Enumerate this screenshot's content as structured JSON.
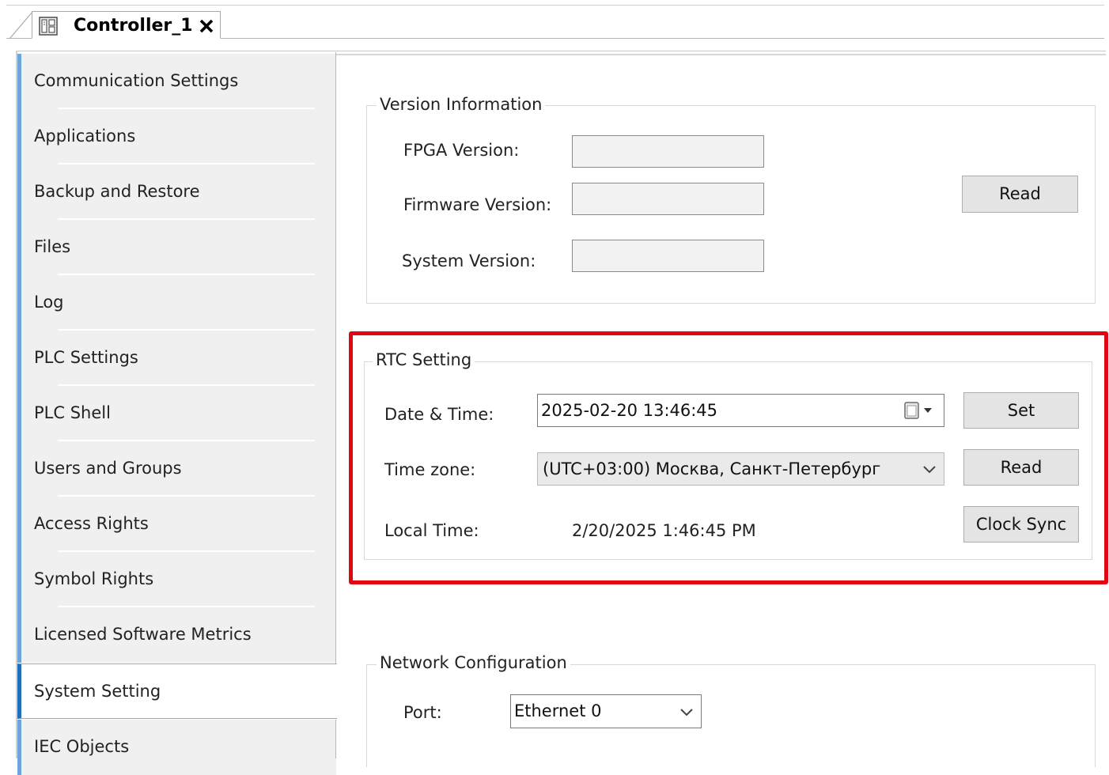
{
  "tab": {
    "title": "Controller_1",
    "close_icon": "close-icon"
  },
  "sidebar": {
    "items": [
      {
        "label": "Communication Settings"
      },
      {
        "label": "Applications"
      },
      {
        "label": "Backup and Restore"
      },
      {
        "label": "Files"
      },
      {
        "label": "Log"
      },
      {
        "label": "PLC Settings"
      },
      {
        "label": "PLC Shell"
      },
      {
        "label": "Users and Groups"
      },
      {
        "label": "Access Rights"
      },
      {
        "label": "Symbol Rights"
      },
      {
        "label": "Licensed Software Metrics"
      },
      {
        "label": "System Setting",
        "active": true
      },
      {
        "label": "IEC Objects"
      }
    ]
  },
  "version_info": {
    "legend": "Version Information",
    "fpga_label": "FPGA Version:",
    "fpga_value": "",
    "firmware_label": "Firmware Version:",
    "firmware_value": "",
    "system_label": "System Version:",
    "system_value": "",
    "read_button": "Read"
  },
  "rtc": {
    "legend": "RTC Setting",
    "datetime_label": "Date & Time:",
    "datetime_value": "2025-02-20 13:46:45",
    "set_button": "Set",
    "timezone_label": "Time zone:",
    "timezone_value": "(UTC+03:00) Москва, Санкт-Петербург",
    "read_button": "Read",
    "localtime_label": "Local Time:",
    "localtime_value": "2/20/2025 1:46:45 PM",
    "clock_sync_button": "Clock Sync"
  },
  "network": {
    "legend": "Network Configuration",
    "port_label": "Port:",
    "port_value": "Ethernet 0"
  },
  "colors": {
    "highlight": "#e10612",
    "active_accent": "#1f6fbf",
    "nav_accent": "#6fa6d9",
    "sidebar_bg": "#f0f0f0"
  }
}
